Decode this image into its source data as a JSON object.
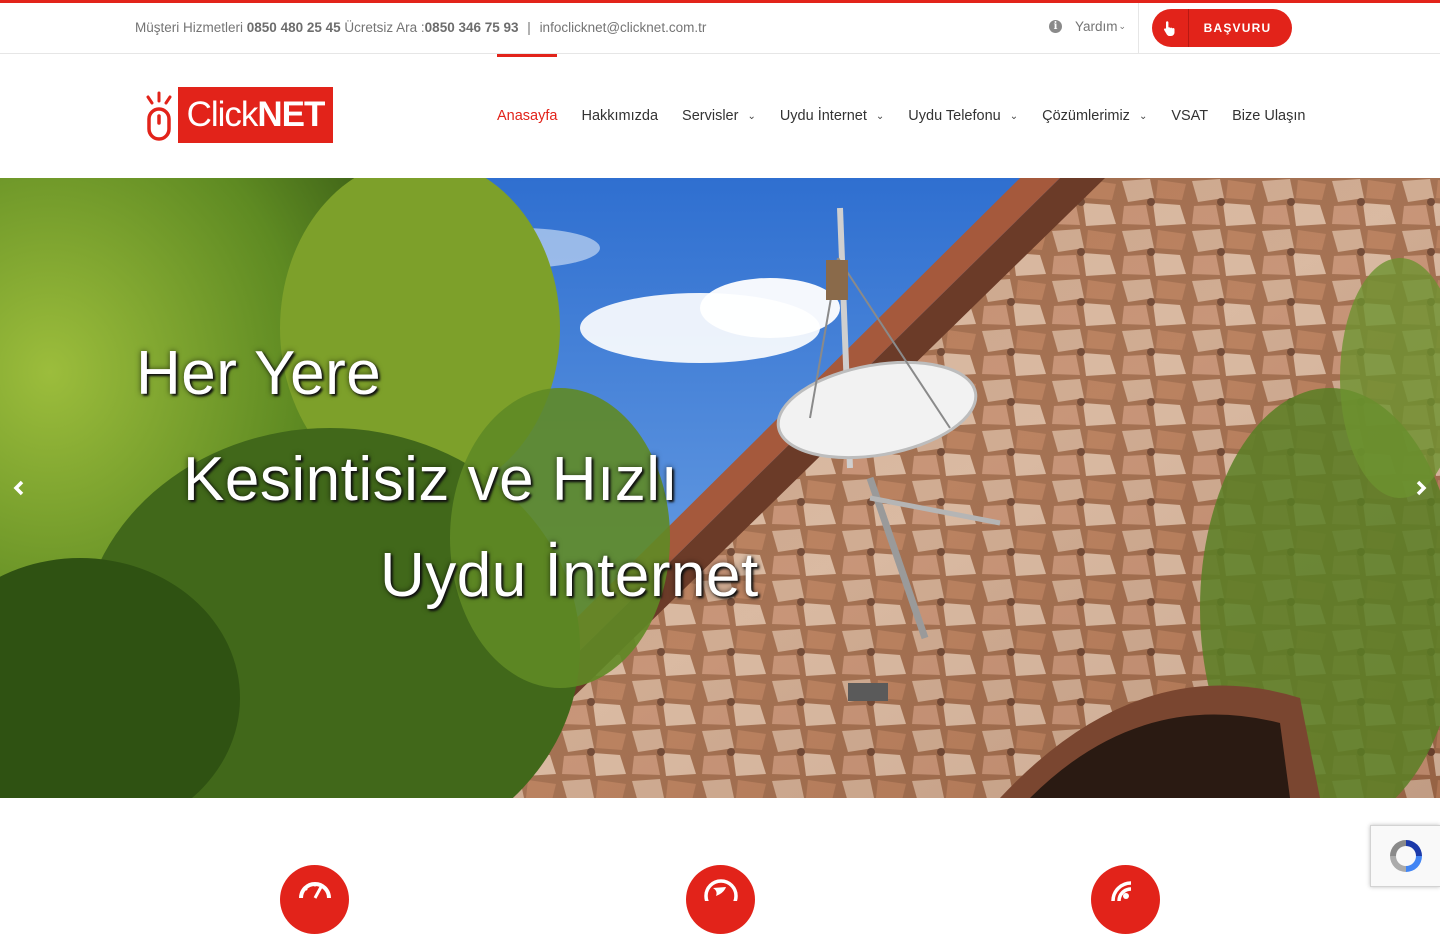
{
  "topbar": {
    "contact_label_1": "Müşteri Hizmetleri",
    "contact_phone_1": "0850 480 25 45",
    "contact_label_2": "Ücretsiz Ara :",
    "contact_phone_2": "0850 346 75 93",
    "separator": "|",
    "email": "infoclicknet@clicknet.com.tr",
    "help_label": "Yardım",
    "apply_label": "BAŞVURU"
  },
  "logo": {
    "text_click": "Click",
    "text_net": "NET"
  },
  "nav": {
    "items": [
      {
        "label": "Anasayfa",
        "active": true,
        "dropdown": false
      },
      {
        "label": "Hakkımızda",
        "active": false,
        "dropdown": false
      },
      {
        "label": "Servisler",
        "active": false,
        "dropdown": true
      },
      {
        "label": "Uydu İnternet",
        "active": false,
        "dropdown": true
      },
      {
        "label": "Uydu Telefonu",
        "active": false,
        "dropdown": true
      },
      {
        "label": "Çözümlerimiz",
        "active": false,
        "dropdown": true
      },
      {
        "label": "VSAT",
        "active": false,
        "dropdown": false
      },
      {
        "label": "Bize Ulaşın",
        "active": false,
        "dropdown": false
      }
    ]
  },
  "hero": {
    "line_1": "Her Yere",
    "line_2": "Kesintisiz ve Hızlı",
    "line_3": "Uydu İnternet",
    "prev_icon": "chevron-left-icon",
    "next_icon": "chevron-right-icon"
  },
  "features": {
    "icons": [
      "speedometer-icon",
      "globe-icon",
      "satellite-signal-icon"
    ]
  },
  "colors": {
    "brand_red": "#e2231a",
    "text_gray": "#747474",
    "nav_text": "#333333"
  }
}
